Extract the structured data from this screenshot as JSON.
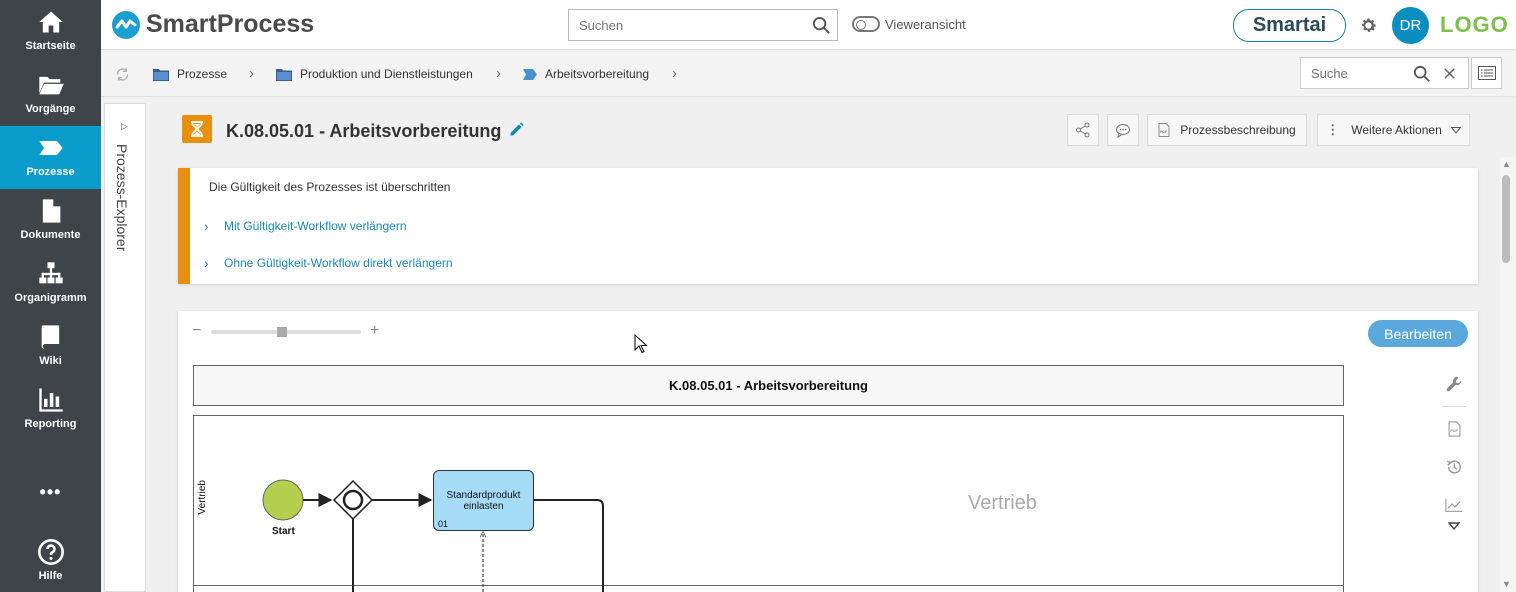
{
  "nav": {
    "items": [
      {
        "label": "Startseite",
        "icon": "home-icon"
      },
      {
        "label": "Vorgänge",
        "icon": "folder-open-icon"
      },
      {
        "label": "Prozesse",
        "icon": "process-chevron-icon",
        "active": true
      },
      {
        "label": "Dokumente",
        "icon": "document-icon"
      },
      {
        "label": "Organigramm",
        "icon": "org-chart-icon"
      },
      {
        "label": "Wiki",
        "icon": "book-icon"
      },
      {
        "label": "Reporting",
        "icon": "bar-chart-icon"
      }
    ],
    "more_label": "•••",
    "help_label": "Hilfe"
  },
  "topbar": {
    "app_name": "SmartProcess",
    "search_placeholder": "Suchen",
    "viewer_label": "Vieweransicht",
    "smartai_label": "Smartai",
    "avatar_initials": "DR",
    "brand_logo": "LOGO"
  },
  "breadcrumb": {
    "items": [
      "Prozesse",
      "Produktion und Dienstleistungen",
      "Arbeitsvorbereitung"
    ],
    "search_placeholder": "Suche"
  },
  "explorer": {
    "label": "Prozess-Explorer"
  },
  "header": {
    "title": "K.08.05.01 - Arbeitsvorbereitung",
    "description_button": "Prozessbeschreibung",
    "more_actions_button": "Weitere Aktionen"
  },
  "alert": {
    "title": "Die Gültigkeit des Prozesses ist überschritten",
    "links": [
      "Mit Gültigkeit-Workflow verlängern",
      "Ohne Gültigkeit-Workflow direkt verlängern"
    ]
  },
  "diagram": {
    "edit_button": "Bearbeiten",
    "pool_title": "K.08.05.01 - Arbeitsvorbereitung",
    "lane_label": "Vertrieb",
    "lane_watermark": "Vertrieb",
    "start_label": "Start",
    "task_label": "Standardprodukt einlasten",
    "task_number": "01",
    "zoom_minus": "−",
    "zoom_plus": "+",
    "zoom_level": 0.47
  },
  "colors": {
    "nav_bg": "#3e4448",
    "nav_active": "#0a9ccb",
    "accent_orange": "#e8900e",
    "link_blue": "#1a8ab0",
    "task_fill": "#a7dcf8",
    "start_event_fill": "#b5cf4f",
    "edit_button": "#5ba8dc",
    "brand_green": "#7cc04b"
  }
}
